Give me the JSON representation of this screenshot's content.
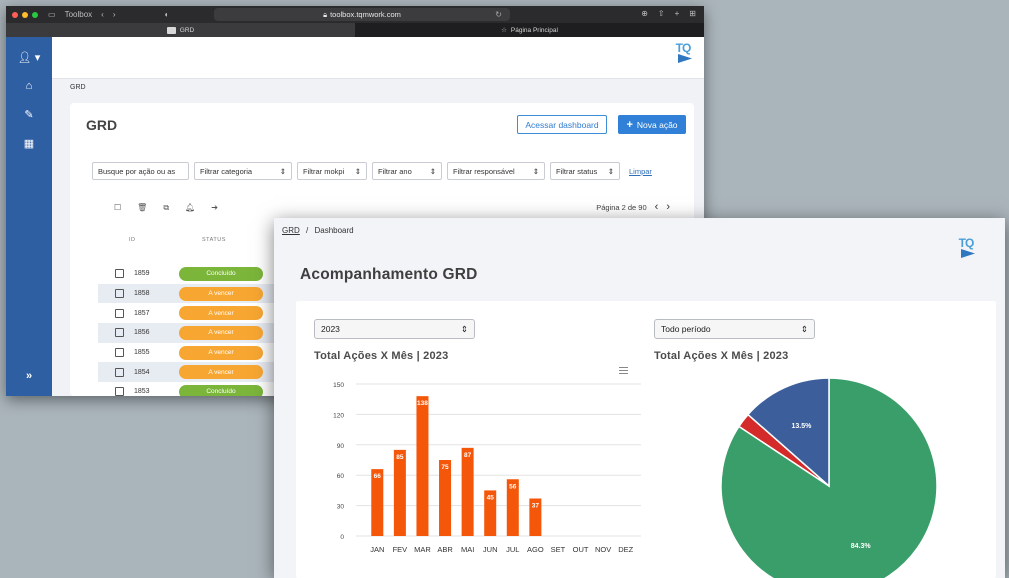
{
  "back_window": {
    "browser": {
      "sidebar_label": "Toolbox",
      "url": "toolbox.tqmwork.com",
      "tabs": [
        {
          "label": "GRD",
          "active": true
        },
        {
          "label": "Página Principal",
          "active": false
        }
      ]
    },
    "logo": {
      "text": "TQ"
    },
    "breadcrumb": "GRD",
    "page_title": "GRD",
    "buttons": {
      "dashboard": "Acessar dashboard",
      "new_action": "Nova ação"
    },
    "filters": {
      "search_placeholder": "Busque por ação ou as",
      "category": "Filtrar categoria",
      "mokpi": "Filtrar mokpi",
      "year": "Filtrar ano",
      "responsible": "Filtrar responsável",
      "status": "Filtrar status",
      "clear": "Limpar"
    },
    "pagination": "Página 2 de 90",
    "columns": {
      "id": "ID",
      "status": "STATUS"
    },
    "rows": [
      {
        "id": "1859",
        "status": "Concluído"
      },
      {
        "id": "1858",
        "status": "A vencer"
      },
      {
        "id": "1857",
        "status": "A vencer"
      },
      {
        "id": "1856",
        "status": "A vencer"
      },
      {
        "id": "1855",
        "status": "A vencer"
      },
      {
        "id": "1854",
        "status": "A vencer"
      },
      {
        "id": "1853",
        "status": "Concluído"
      }
    ],
    "status_colors": {
      "Concluído": "#7bb53a",
      "A vencer": "#f7a632"
    }
  },
  "front_window": {
    "logo": {
      "text": "TQ"
    },
    "breadcrumb": {
      "link": "GRD",
      "separator": "/",
      "current": "Dashboard"
    },
    "page_title": "Acompanhamento GRD",
    "year_select": "2023",
    "period_select": "Todo período",
    "bar_title": "Total Ações X Mês | 2023",
    "pie_title": "Total Ações X Mês | 2023"
  },
  "chart_data": [
    {
      "type": "bar",
      "title": "Total Ações X Mês | 2023",
      "categories": [
        "JAN",
        "FEV",
        "MAR",
        "ABR",
        "MAI",
        "JUN",
        "JUL",
        "AGO",
        "SET",
        "OUT",
        "NOV",
        "DEZ"
      ],
      "values": [
        66,
        85,
        138,
        75,
        87,
        45,
        56,
        37,
        null,
        null,
        null,
        null
      ],
      "ylim": [
        0,
        150
      ],
      "yticks": [
        0,
        30,
        60,
        90,
        120,
        150
      ],
      "grid": true,
      "color": "#f4560a"
    },
    {
      "type": "pie",
      "title": "Total Ações X Mês | 2023",
      "slices": [
        {
          "value": 84.3,
          "label": "84.3%",
          "color": "#3a9e6a"
        },
        {
          "value": 2.2,
          "label": "",
          "color": "#d42a2a"
        },
        {
          "value": 13.5,
          "label": "13.5%",
          "color": "#3c5f9c"
        }
      ]
    }
  ]
}
